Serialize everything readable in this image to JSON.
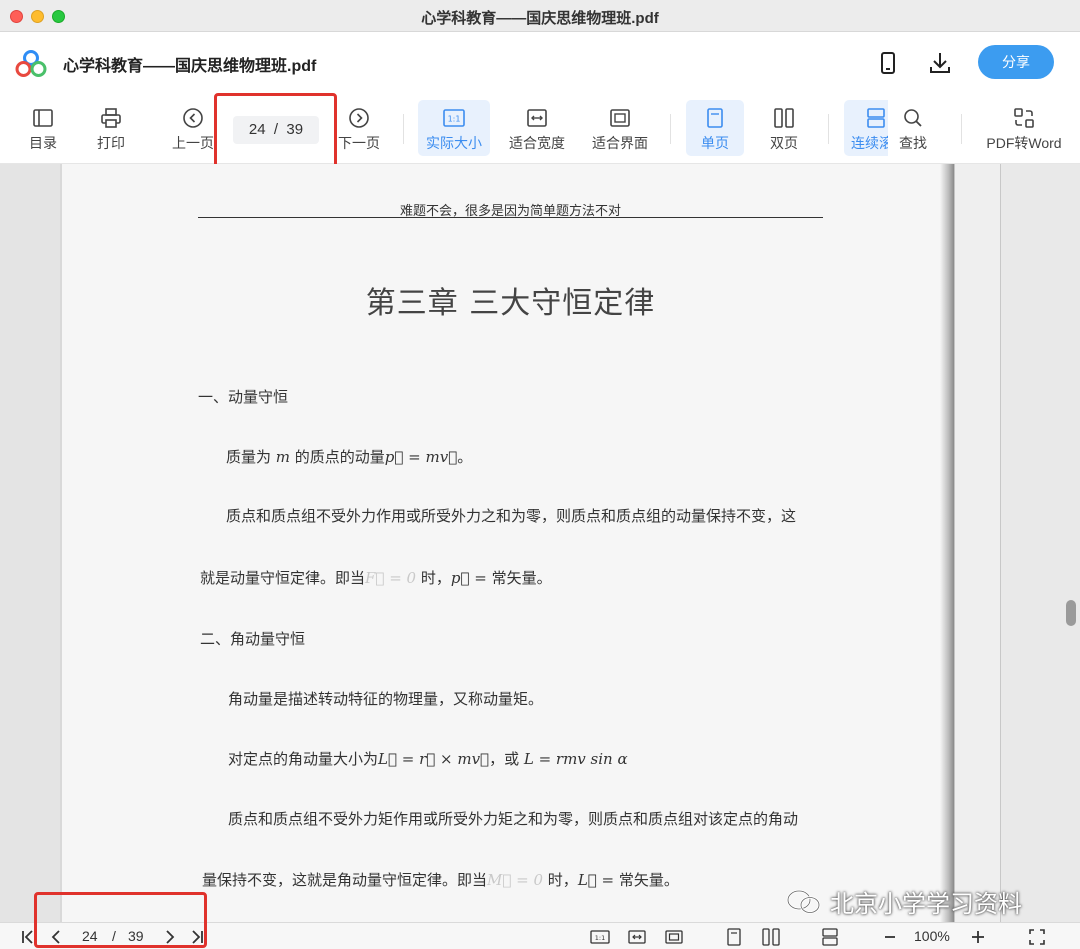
{
  "window": {
    "title": "心学科教育——国庆思维物理班.pdf"
  },
  "header": {
    "doc_title": "心学科教育——国庆思维物理班.pdf",
    "share_label": "分享"
  },
  "toolbar": {
    "toc": "目录",
    "print": "打印",
    "prev": "上一页",
    "page_current": "24",
    "page_sep": "/",
    "page_total": "39",
    "next": "下一页",
    "actual_size": "实际大小",
    "actual_size_glyph": "1:1",
    "fit_width": "适合宽度",
    "fit_page": "适合界面",
    "single_page": "单页",
    "double_page": "双页",
    "continuous": "连续滚",
    "search": "查找",
    "pdf_to_word": "PDF转Word"
  },
  "document": {
    "header_text": "难题不会，很多是因为简单题方法不对",
    "chapter_title": "第三章  三大守恒定律",
    "s1_heading": "一、动量守恒",
    "p1_pre": "质量为 ",
    "p1_m": "m",
    "p1_mid": " 的质点的动量",
    "p1_eq": "p⃗ = mv⃗",
    "p1_end": "。",
    "p2_line1": "质点和质点组不受外力作用或所受外力之和为零，则质点和质点组的动量保持不变，这",
    "p2_line2_pre": "就是动量守恒定律。即当",
    "p2_line2_faded": "F⃗ = 0",
    "p2_line2_mid": " 时，",
    "p2_line2_eq": "p⃗ =",
    "p2_line2_end": " 常矢量。",
    "s2_heading": "二、角动量守恒",
    "p3": "角动量是描述转动特征的物理量，又称动量矩。",
    "p4_pre": "对定点的角动量大小为",
    "p4_eq1": "L⃗ = r⃗ × mv⃗",
    "p4_mid": "，或 ",
    "p4_eq2": "L = rmv sin α",
    "p5_line1": "质点和质点组不受外力矩作用或所受外力矩之和为零，则质点和质点组对该定点的角动",
    "p5_line2_pre": "量保持不变，这就是角动量守恒定律。即当",
    "p5_line2_faded": "M⃗ = 0",
    "p5_line2_mid": " 时，",
    "p5_line2_eq": "L⃗ =",
    "p5_line2_end": " 常矢量。"
  },
  "statusbar": {
    "page_current": "24",
    "page_sep": "/",
    "page_total": "39",
    "zoom": "100%",
    "actual_size_glyph": "1:1"
  },
  "watermark": {
    "text": "北京小学学习资料"
  },
  "colors": {
    "accent": "#3c9cf0",
    "highlight_box": "#e0322c",
    "active_bg": "#e8f1fd"
  }
}
